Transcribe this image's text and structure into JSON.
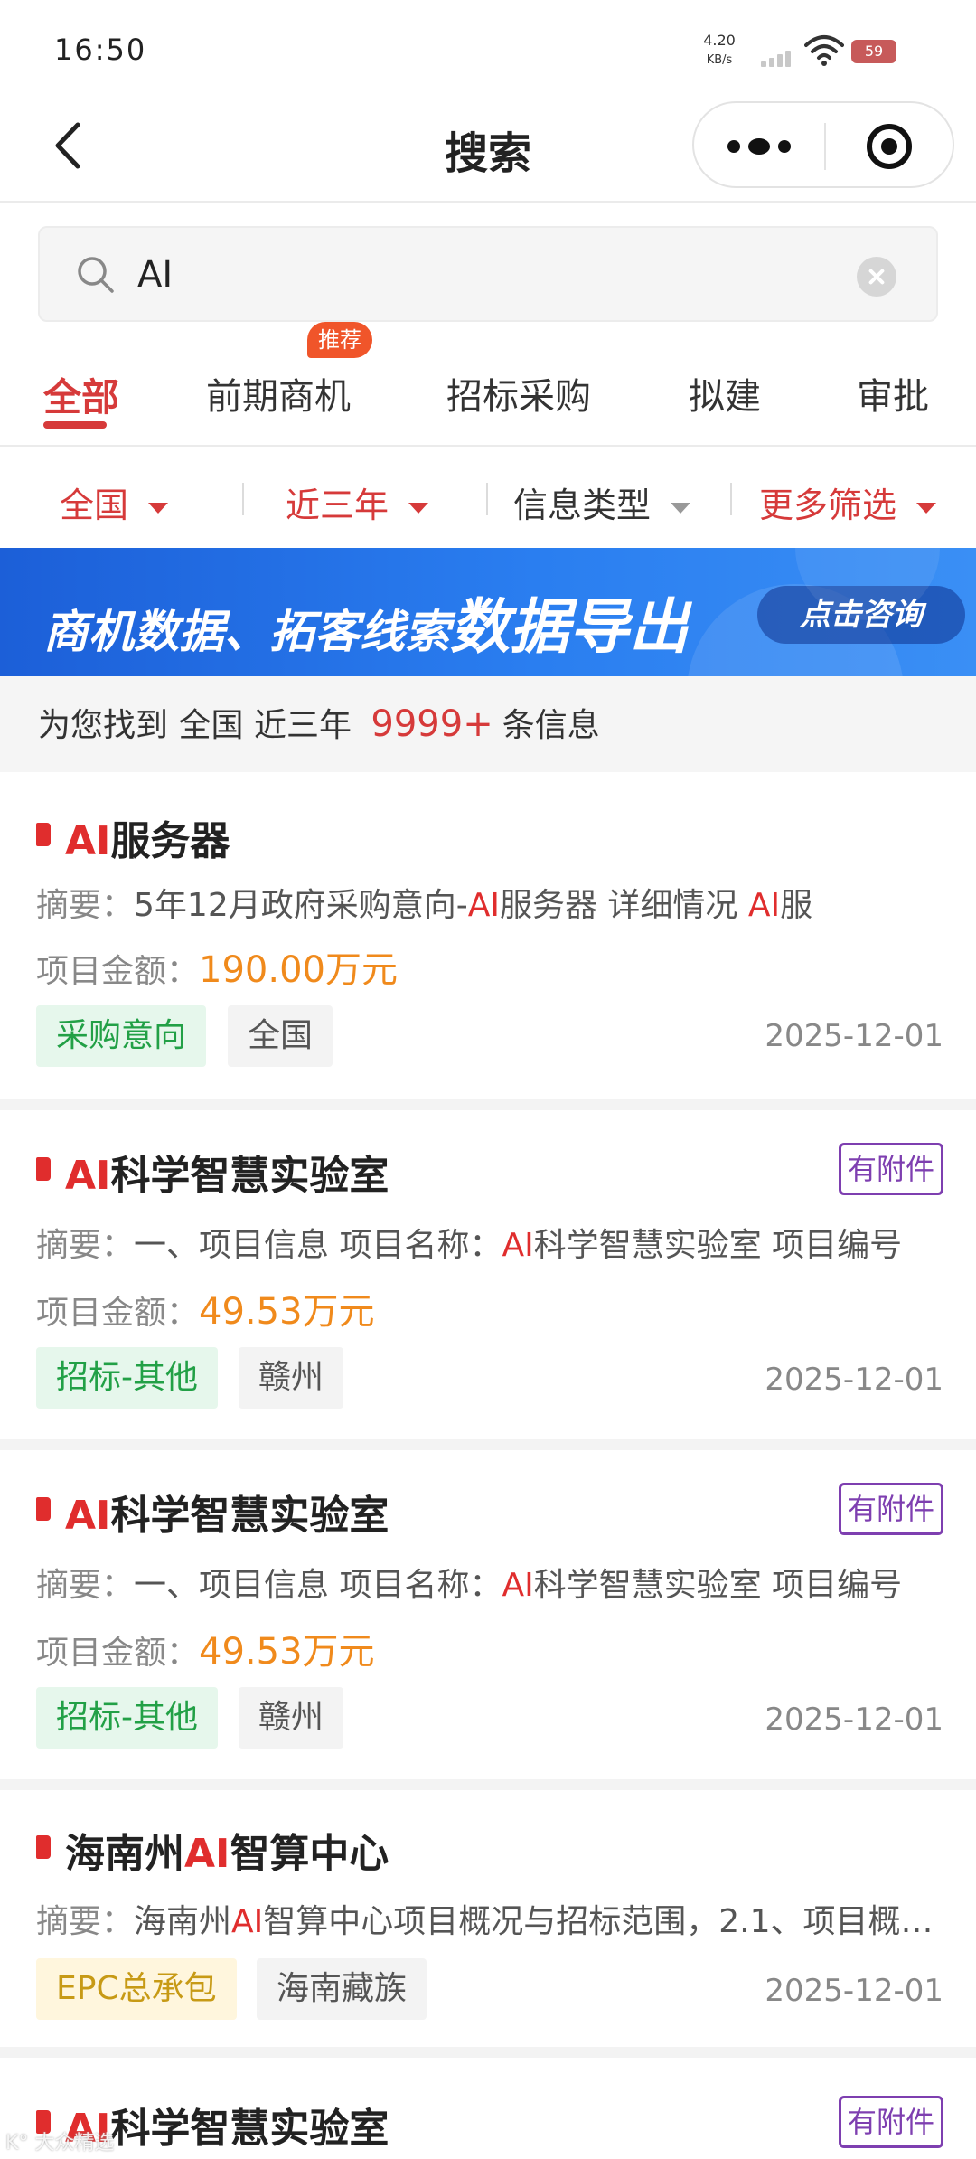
{
  "status_bar": {
    "time": "16:50",
    "speed_value": "4.20",
    "speed_unit": "KB/s",
    "battery": "59"
  },
  "header": {
    "title": "搜索"
  },
  "search": {
    "value": "AI"
  },
  "tabs": [
    {
      "label": "全部",
      "active": true
    },
    {
      "label": "前期商机",
      "badge": "推荐"
    },
    {
      "label": "招标采购"
    },
    {
      "label": "拟建"
    },
    {
      "label": "审批"
    }
  ],
  "filters": [
    {
      "label": "全国"
    },
    {
      "label": "近三年"
    },
    {
      "label": "信息类型"
    },
    {
      "label": "更多筛选"
    }
  ],
  "banner": {
    "text_small": "商机数据、拓客线索",
    "text_big": "数据导出",
    "button": "点击咨询"
  },
  "result_summary": {
    "prefix": "为您找到",
    "region": "全国",
    "period": "近三年",
    "count": "9999+",
    "suffix": "条信息"
  },
  "results": [
    {
      "title_hl": "AI",
      "title_rest": "服务器",
      "summary_label": "摘要：",
      "summary_parts": [
        "5年12月政府采购意向-",
        "AI",
        "服务器 详细情况 ",
        "AI",
        "服"
      ],
      "amount_label": "项目金额：",
      "amount": "190.00万元",
      "tags": [
        "采购意向",
        "全国"
      ],
      "date": "2025-12-01"
    },
    {
      "title_hl": "AI",
      "title_rest": "科学智慧实验室",
      "attachment": "有附件",
      "summary_label": "摘要：",
      "summary_parts": [
        "一、项目信息 项目名称：",
        "AI",
        "科学智慧实验室 项目编号"
      ],
      "amount_label": "项目金额：",
      "amount": "49.53万元",
      "tags": [
        "招标-其他",
        "赣州"
      ],
      "date": "2025-12-01"
    },
    {
      "title_hl": "AI",
      "title_rest": "科学智慧实验室",
      "attachment": "有附件",
      "summary_label": "摘要：",
      "summary_parts": [
        "一、项目信息 项目名称：",
        "AI",
        "科学智慧实验室 项目编号"
      ],
      "amount_label": "项目金额：",
      "amount": "49.53万元",
      "tags": [
        "招标-其他",
        "赣州"
      ],
      "date": "2025-12-01"
    },
    {
      "title_pre": "海南州",
      "title_hl": "AI",
      "title_rest": "智算中心",
      "summary_label": "摘要：",
      "summary_parts": [
        "海南州",
        "AI",
        "智算中心项目概况与招标范围，2.1、项目概…"
      ],
      "tags": [
        "EPC总承包",
        "海南藏族"
      ],
      "date": "2025-12-01"
    },
    {
      "title_hl": "AI",
      "title_rest": "科学智慧实验室",
      "attachment": "有附件"
    }
  ],
  "watermark": "K° 大众精选",
  "colors": {
    "accent_red": "#d63a3a",
    "amount_orange": "#f08a1c",
    "attach_purple": "#7e3fb0",
    "banner_blue": "#2a7ef0"
  }
}
